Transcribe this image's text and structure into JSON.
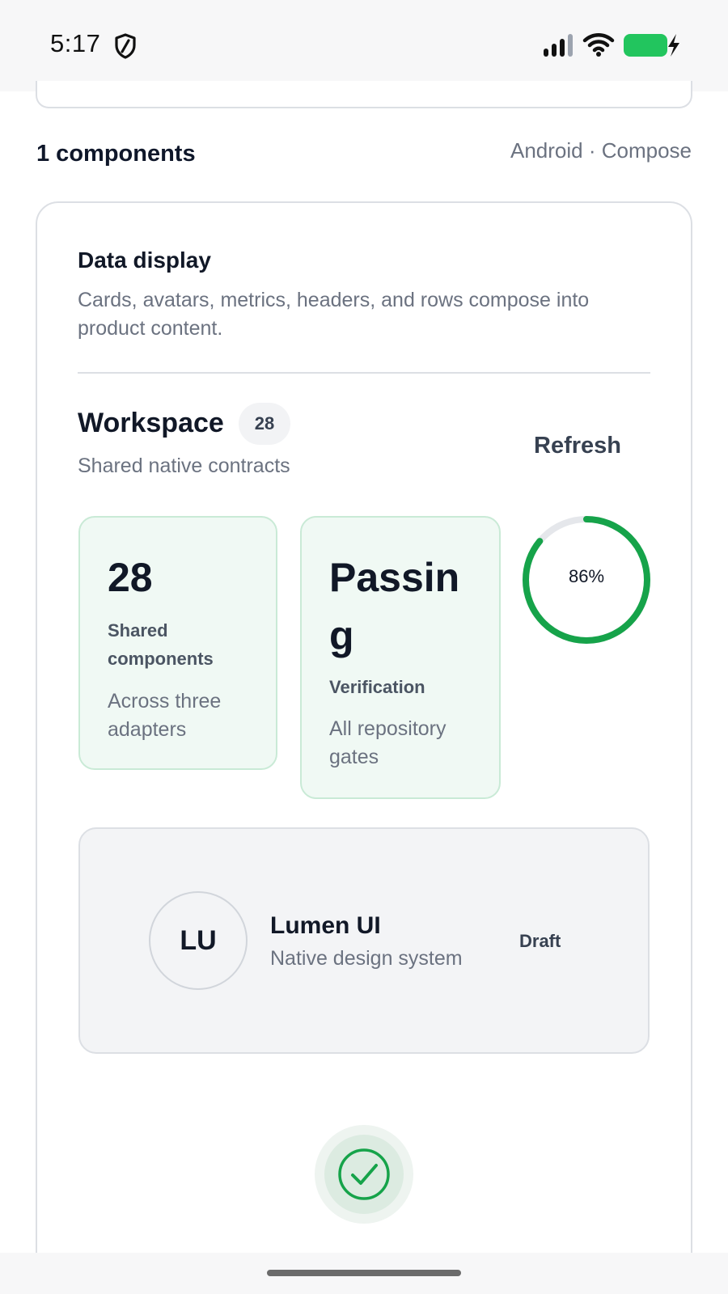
{
  "status_bar": {
    "time": "5:17",
    "battery_color": "#22c55e"
  },
  "section": {
    "count_label": "1 components",
    "platform_label": "Android · Compose"
  },
  "card": {
    "title": "Data display",
    "description": "Cards, avatars, metrics, headers, and rows compose into product content."
  },
  "workspace": {
    "title": "Workspace",
    "badge": "28",
    "subtitle": "Shared native contracts",
    "refresh_label": "Refresh"
  },
  "metrics": [
    {
      "value": "28",
      "label": "Shared components",
      "note": "Across three adapters"
    },
    {
      "value": "Passing",
      "label": "Verification",
      "note": "All repository gates"
    }
  ],
  "progress": {
    "percent": 86,
    "label": "86%",
    "color": "#16a34a",
    "track_color": "#e5e7eb"
  },
  "profile": {
    "initials": "LU",
    "name": "Lumen UI",
    "subtitle": "Native design system",
    "status": "Draft"
  },
  "success": {
    "icon": "check-circle-icon",
    "color": "#16a34a"
  }
}
